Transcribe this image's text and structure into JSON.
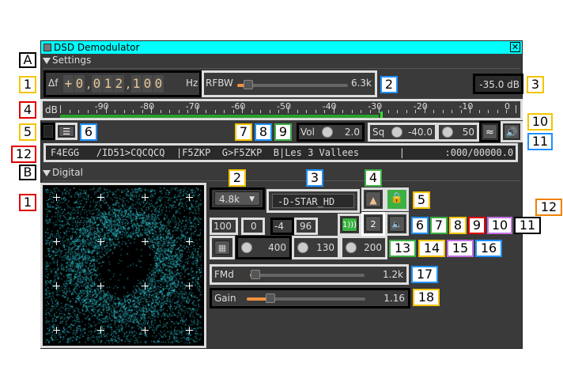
{
  "window": {
    "title": "DSD Demodulator"
  },
  "sections": {
    "settings": "Settings",
    "digital": "Digital"
  },
  "callouts": {
    "A": "A",
    "B": "B",
    "s1": "1",
    "s2": "2",
    "s3": "3",
    "s4": "4",
    "s5": "5",
    "s6": "6",
    "s7": "7",
    "s8": "8",
    "s9": "9",
    "s10": "10",
    "s11": "11",
    "s12": "12",
    "d1": "1",
    "d2": "2",
    "d3": "3",
    "d4": "4",
    "d5": "5",
    "d6": "6",
    "d7": "7",
    "d8": "8",
    "d9": "9",
    "d10": "10",
    "d11": "11",
    "d12": "12",
    "d13": "13",
    "d14": "14",
    "d15": "15",
    "d16": "16",
    "d17": "17",
    "d18": "18"
  },
  "settings": {
    "delta_f_label": "Δf",
    "freq_sign": "+",
    "freq_digits": [
      "0",
      "0",
      "1",
      "2",
      "1",
      "0",
      "0"
    ],
    "freq_sep": ",",
    "freq_unit": "Hz",
    "rfbw_label": "RFBW",
    "rfbw_value": "6.3k",
    "rfbw_fraction": 0.1,
    "power_db": "-35.0 dB",
    "meter_label": "dB",
    "meter_scale": [
      "-90",
      "-80",
      "-70",
      "-60",
      "-50",
      "-40",
      "-30",
      "-20",
      "-10",
      "0"
    ],
    "meter_level_db": -30,
    "vol_label": "Vol",
    "vol_value": "2.0",
    "sq_label": "Sq",
    "sq_value": "-40.0",
    "sq_gate_value": "50",
    "status_text": "F4EGG   /ID51>CQCQCQ  |F5ZKP  G>F5ZKP  B|Les 3 Vallees       |       :000/00000.0"
  },
  "digital": {
    "baudrate": "4.8k",
    "sync_type": "-D-STAR_HD",
    "in_level": "100",
    "carrier_pos": "0",
    "zero_crossing": "-4",
    "sync_rate": "96",
    "slot_button": "2",
    "trace_length": "400",
    "trace_stroke": "130",
    "trace_decay": "200",
    "fmd_label": "FMd",
    "fmd_value": "1.2k",
    "fmd_fraction": 0.05,
    "gain_label": "Gain",
    "gain_value": "1.16",
    "gain_fraction": 0.2
  },
  "colors": {
    "yellow": "#f4c400",
    "blue": "#1e90ff",
    "red": "#e00000",
    "green": "#3cb043",
    "orange": "#f08000",
    "purple": "#c070e0",
    "cyan": "#00ffff",
    "scope": "#2fd0e0"
  }
}
